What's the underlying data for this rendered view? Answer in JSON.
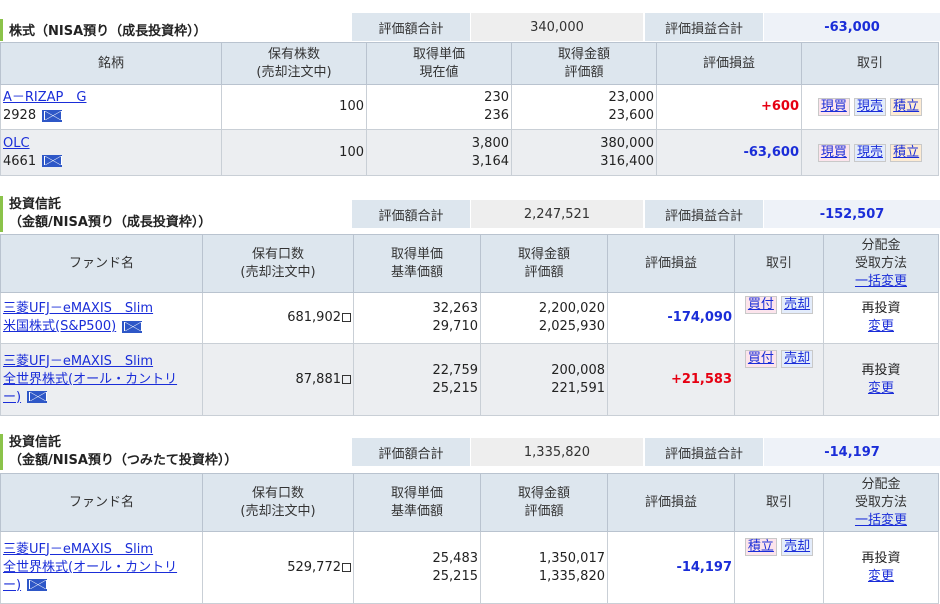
{
  "stocks": {
    "title": "株式（NISA預り（成長投資枠））",
    "eval_total_label": "評価額合計",
    "eval_total_value": "340,000",
    "pl_total_label": "評価損益合計",
    "pl_total_value": "-63,000",
    "headers": {
      "name": "銘柄",
      "qty_line1": "保有株数",
      "qty_line2": "(売却注文中)",
      "unit_line1": "取得単価",
      "unit_line2": "現在値",
      "amount_line1": "取得金額",
      "amount_line2": "評価額",
      "pl": "評価損益",
      "trade": "取引"
    },
    "rows": [
      {
        "name": "A－RIZAP　G",
        "code": "2928",
        "qty": "100",
        "cost_unit": "230",
        "current": "236",
        "cost_amount": "23,000",
        "eval_amount": "23,600",
        "pl": "+600",
        "btn1": "現買",
        "btn2": "現売",
        "btn3": "積立"
      },
      {
        "name": "OLC",
        "code": "4661",
        "qty": "100",
        "cost_unit": "3,800",
        "current": "3,164",
        "cost_amount": "380,000",
        "eval_amount": "316,400",
        "pl": "-63,600",
        "btn1": "現買",
        "btn2": "現売",
        "btn3": "積立"
      }
    ]
  },
  "fund1": {
    "title_line1": "投資信託",
    "title_line2": "（金額/NISA預り（成長投資枠））",
    "eval_total_label": "評価額合計",
    "eval_total_value": "2,247,521",
    "pl_total_label": "評価損益合計",
    "pl_total_value": "-152,507",
    "headers": {
      "name": "ファンド名",
      "qty_line1": "保有口数",
      "qty_line2": "(売却注文中)",
      "unit_line1": "取得単価",
      "unit_line2": "基準価額",
      "amount_line1": "取得金額",
      "amount_line2": "評価額",
      "pl": "評価損益",
      "trade": "取引",
      "dist_line1": "分配金",
      "dist_line2": "受取方法",
      "dist_line3": "一括変更"
    },
    "rows": [
      {
        "name_line1": "三菱UFJ－eMAXIS　Slim",
        "name_line2": "米国株式(S&P500)",
        "name_line3": "",
        "qty": "681,902",
        "cost_unit": "32,263",
        "nav": "29,710",
        "cost_amount": "2,200,020",
        "eval_amount": "2,025,930",
        "pl": "-174,090",
        "btn1": "買付",
        "btn2": "売却",
        "dist": "再投資",
        "dist_change": "変更"
      },
      {
        "name_line1": "三菱UFJ－eMAXIS　Slim",
        "name_line2": "全世界株式(オール・カントリ",
        "name_line3": "ー)",
        "qty": "87,881",
        "cost_unit": "22,759",
        "nav": "25,215",
        "cost_amount": "200,008",
        "eval_amount": "221,591",
        "pl": "+21,583",
        "btn1": "買付",
        "btn2": "売却",
        "dist": "再投資",
        "dist_change": "変更"
      }
    ]
  },
  "fund2": {
    "title_line1": "投資信託",
    "title_line2": "（金額/NISA預り（つみたて投資枠））",
    "eval_total_label": "評価額合計",
    "eval_total_value": "1,335,820",
    "pl_total_label": "評価損益合計",
    "pl_total_value": "-14,197",
    "headers": {
      "name": "ファンド名",
      "qty_line1": "保有口数",
      "qty_line2": "(売却注文中)",
      "unit_line1": "取得単価",
      "unit_line2": "基準価額",
      "amount_line1": "取得金額",
      "amount_line2": "評価額",
      "pl": "評価損益",
      "trade": "取引",
      "dist_line1": "分配金",
      "dist_line2": "受取方法",
      "dist_line3": "一括変更"
    },
    "rows": [
      {
        "name_line1": "三菱UFJ－eMAXIS　Slim",
        "name_line2": "全世界株式(オール・カントリ",
        "name_line3": "ー)",
        "qty": "529,772",
        "cost_unit": "25,483",
        "nav": "25,215",
        "cost_amount": "1,350,017",
        "eval_amount": "1,335,820",
        "pl": "-14,197",
        "btn1": "積立",
        "btn2": "売却",
        "dist": "再投資",
        "dist_change": "変更"
      }
    ]
  }
}
